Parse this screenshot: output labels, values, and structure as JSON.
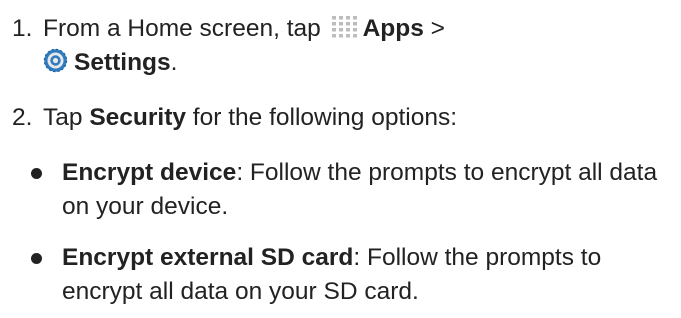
{
  "steps": [
    {
      "number": "1.",
      "text_a": "From a Home screen, tap ",
      "apps_icon": "apps-grid-icon",
      "apps_label": "Apps",
      "separator": " >",
      "settings_icon": "settings-gear-icon",
      "settings_label": "Settings",
      "end": "."
    },
    {
      "number": "2.",
      "text_a": "Tap ",
      "security_label": "Security",
      "text_b": " for the following options:"
    }
  ],
  "bullets": [
    {
      "term": "Encrypt device",
      "description": ": Follow the prompts to encrypt all data on your device."
    },
    {
      "term": "Encrypt external SD card",
      "description": ": Follow the prompts to encrypt all data on your SD card."
    }
  ],
  "colors": {
    "text": "#222222",
    "icon_blue": "#2f7bbf",
    "icon_light": "#e8e8e8"
  }
}
